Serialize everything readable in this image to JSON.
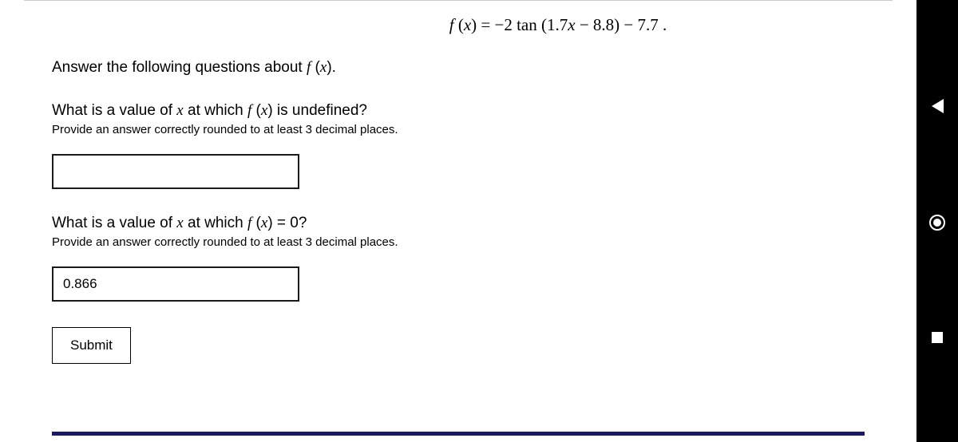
{
  "equation_html": "<span class='math-fn'>f</span> (<span class='math-var'>x</span>) = −2 tan (1.7<span class='math-var'>x</span> − 8.8) − 7.7 .",
  "intro_html": "Answer the following questions about <span class='math-fn'>f</span> (<span class='math-var'>x</span>).",
  "question1": {
    "text_html": "What is a value of <span class='math-var'>x</span> at which <span class='math-fn'>f</span> (<span class='math-var'>x</span>) is undefined?",
    "hint": "Provide an answer correctly rounded to at least 3 decimal places.",
    "value": ""
  },
  "question2": {
    "text_html": "What is a value of <span class='math-var'>x</span> at which <span class='math-fn'>f</span> (<span class='math-var'>x</span>) = 0?",
    "hint": "Provide an answer correctly rounded to at least 3 decimal places.",
    "value": "0.866"
  },
  "submit_label": "Submit"
}
